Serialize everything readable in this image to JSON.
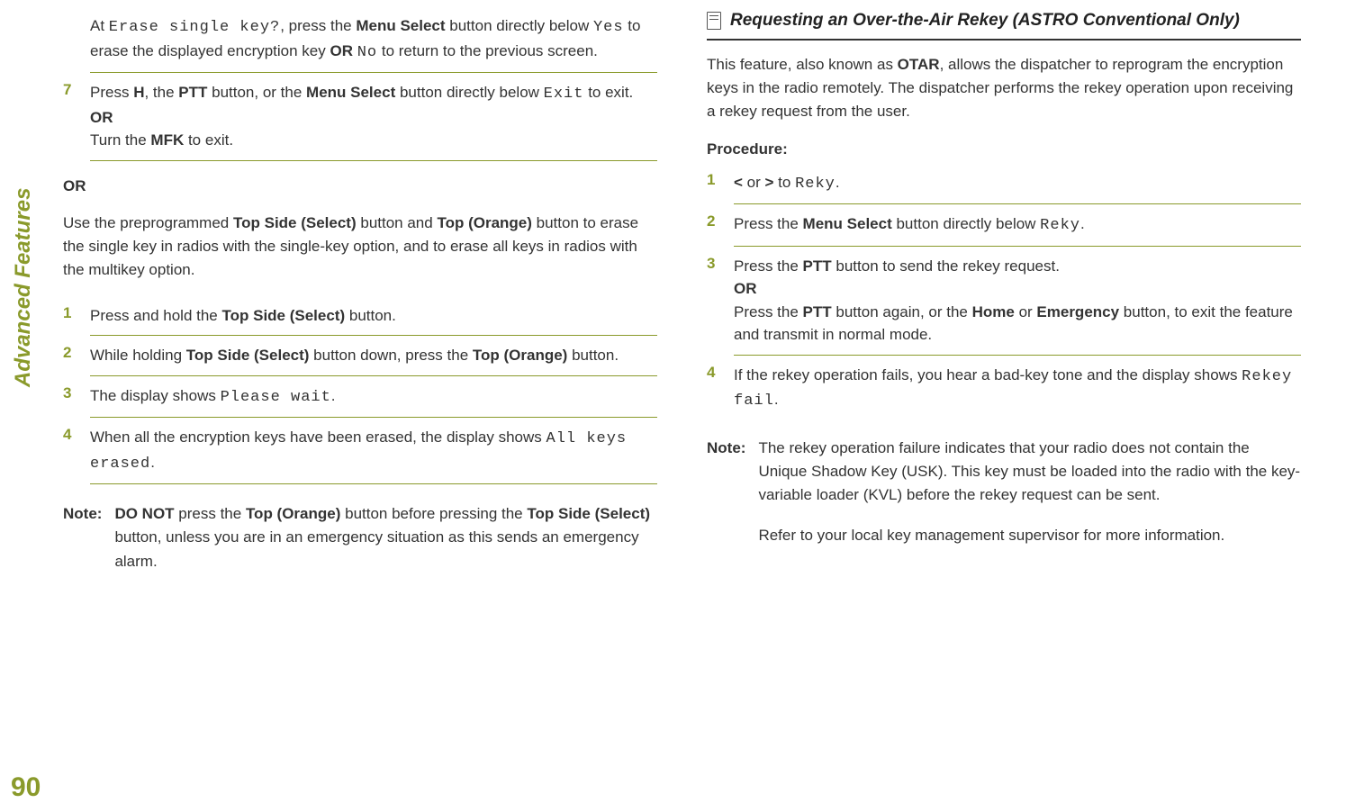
{
  "sidebar_label": "Advanced Features",
  "page_number": "90",
  "left": {
    "step6_prefix": "At ",
    "step6_mono1": "Erase single key?",
    "step6_mid1": ", press the ",
    "step6_b1": "Menu Select",
    "step6_mid2": " button directly below ",
    "step6_mono2": "Yes",
    "step6_mid3": " to erase the displayed encryption key ",
    "step6_bor": "OR",
    "step6_sp": " ",
    "step6_mono3": "No",
    "step6_end": " to return to the previous screen.",
    "s7_num": "7",
    "s7_t1": "Press ",
    "s7_home": "H",
    "s7_t2": ", the ",
    "s7_b1": "PTT",
    "s7_t3": " button, or the ",
    "s7_b2": "Menu Select",
    "s7_t4": " button directly below ",
    "s7_mono": "Exit",
    "s7_t5": " to exit.",
    "s7_or": "OR",
    "s7_t6": "Turn the ",
    "s7_b3": "MFK",
    "s7_t7": " to exit.",
    "or_standalone": "OR",
    "para_t1": "Use the preprogrammed ",
    "para_b1": "Top Side (Select)",
    "para_t2": " button and ",
    "para_b2": "Top (Orange)",
    "para_t3": " button to erase the single key in radios with the single-key option, and to erase all keys in radios with the multikey option.",
    "b1_num": "1",
    "b1_t1": "Press and hold the ",
    "b1_b1": "Top Side (Select)",
    "b1_t2": " button.",
    "b2_num": "2",
    "b2_t1": "While holding ",
    "b2_b1": "Top Side (Select)",
    "b2_t2": " button down, press the ",
    "b2_b2": "Top (Orange)",
    "b2_t3": " button.",
    "b3_num": "3",
    "b3_t1": "The display shows ",
    "b3_mono": "Please wait",
    "b3_t2": ".",
    "b4_num": "4",
    "b4_t1": "When all the encryption keys have been erased, the display shows ",
    "b4_mono": "All keys erased",
    "b4_t2": ".",
    "note_label": "Note:",
    "note_b1": "DO NOT",
    "note_t1": " press the ",
    "note_b2": "Top (Orange)",
    "note_t2": " button before pressing the ",
    "note_b3": "Top Side (Select)",
    "note_t3": " button, unless you are in an emergency situation as this sends an emergency alarm."
  },
  "right": {
    "heading": "Requesting an Over-the-Air Rekey (ASTRO Conventional Only)",
    "intro_t1": "This feature, also known as ",
    "intro_b1": "OTAR",
    "intro_t2": ", allows the dispatcher to reprogram the encryption keys in the radio remotely. The dispatcher performs the rekey operation upon receiving a rekey request from the user.",
    "procedure_label": "Procedure:",
    "r1_num": "1",
    "r1_lt": "<",
    "r1_mid": " or ",
    "r1_gt": ">",
    "r1_t2": " to ",
    "r1_mono": "Reky",
    "r1_t3": ".",
    "r2_num": "2",
    "r2_t1": "Press the ",
    "r2_b1": "Menu Select",
    "r2_t2": " button directly below ",
    "r2_mono": "Reky",
    "r2_t3": ".",
    "r3_num": "3",
    "r3_t1": "Press the ",
    "r3_b1": "PTT",
    "r3_t2": " button to send the rekey request.",
    "r3_or": "OR",
    "r3_t3": "Press the ",
    "r3_b2": "PTT",
    "r3_t4": " button again, or the ",
    "r3_b3": "Home",
    "r3_t5": " or ",
    "r3_b4": "Emergency",
    "r3_t6": " button, to exit the feature and transmit in normal mode.",
    "r4_num": "4",
    "r4_t1": "If the rekey operation fails, you hear a bad-key tone and the display shows ",
    "r4_mono": "Rekey fail",
    "r4_t2": ".",
    "rnote_label": "Note:",
    "rnote_t1": "The rekey operation failure indicates that your radio does not contain the Unique Shadow Key (USK). This key must be loaded into the radio with the key-variable loader (KVL) before the rekey request can be sent.",
    "rnote_t2": "Refer to your local key management supervisor for more information."
  }
}
